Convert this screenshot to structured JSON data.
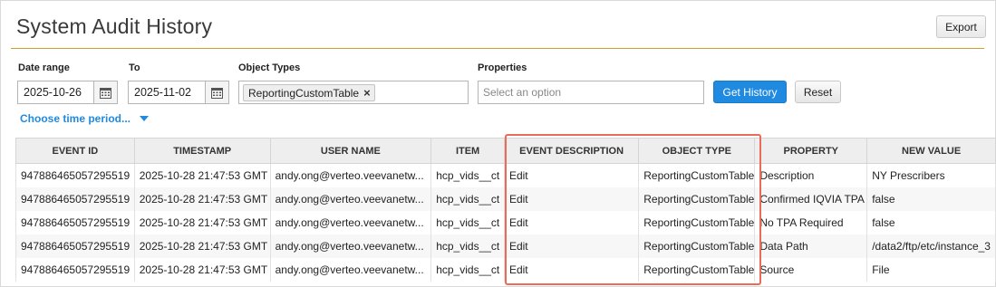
{
  "page": {
    "title": "System Audit History",
    "export_label": "Export"
  },
  "filters": {
    "date_range_label": "Date range",
    "date_from": "2025-10-26",
    "to_label": "To",
    "date_to": "2025-11-02",
    "object_types_label": "Object Types",
    "object_type_chip": "ReportingCustomTable",
    "properties_label": "Properties",
    "properties_placeholder": "Select an option",
    "get_history_label": "Get History",
    "reset_label": "Reset",
    "time_period_label": "Choose time period..."
  },
  "table": {
    "columns": [
      "EVENT ID",
      "TIMESTAMP",
      "USER NAME",
      "ITEM",
      "EVENT DESCRIPTION",
      "OBJECT TYPE",
      "PROPERTY",
      "NEW VALUE"
    ],
    "rows": [
      [
        "947886465057295519",
        "2025-10-28 21:47:53 GMT",
        "andy.ong@verteo.veevanetw...",
        "hcp_vids__ct",
        "Edit",
        "ReportingCustomTable",
        "Description",
        "NY Prescribers"
      ],
      [
        "947886465057295519",
        "2025-10-28 21:47:53 GMT",
        "andy.ong@verteo.veevanetw...",
        "hcp_vids__ct",
        "Edit",
        "ReportingCustomTable",
        "Confirmed IQVIA TPA",
        "false"
      ],
      [
        "947886465057295519",
        "2025-10-28 21:47:53 GMT",
        "andy.ong@verteo.veevanetw...",
        "hcp_vids__ct",
        "Edit",
        "ReportingCustomTable",
        "No TPA Required",
        "false"
      ],
      [
        "947886465057295519",
        "2025-10-28 21:47:53 GMT",
        "andy.ong@verteo.veevanetw...",
        "hcp_vids__ct",
        "Edit",
        "ReportingCustomTable",
        "Data Path",
        "/data2/ftp/etc/instance_3"
      ],
      [
        "947886465057295519",
        "2025-10-28 21:47:53 GMT",
        "andy.ong@verteo.veevanetw...",
        "hcp_vids__ct",
        "Edit",
        "ReportingCustomTable",
        "Source",
        "File"
      ]
    ]
  },
  "colors": {
    "accent": "#1f8ae0",
    "title_rule": "#c9a227",
    "highlight": "#ea6b57"
  },
  "icons": {
    "calendar": "calendar-icon",
    "remove_chip": "close-icon",
    "dropdown": "chevron-down-icon"
  }
}
